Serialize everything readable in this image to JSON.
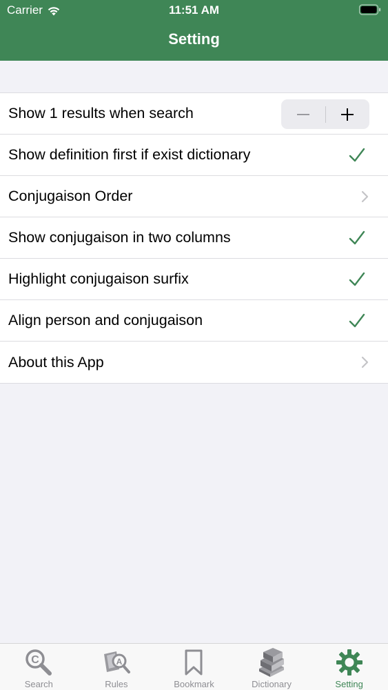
{
  "status_bar": {
    "carrier": "Carrier",
    "time": "11:51 AM"
  },
  "nav": {
    "title": "Setting"
  },
  "settings": {
    "rows": [
      {
        "label": "Show 1 results when search",
        "accessory": "stepper"
      },
      {
        "label": "Show definition first if exist dictionary",
        "accessory": "checkmark"
      },
      {
        "label": "Conjugaison Order",
        "accessory": "chevron"
      },
      {
        "label": "Show conjugaison in two columns",
        "accessory": "checkmark"
      },
      {
        "label": "Highlight conjugaison surfix",
        "accessory": "checkmark"
      },
      {
        "label": "Align person and conjugaison",
        "accessory": "checkmark"
      },
      {
        "label": "About this App",
        "accessory": "chevron"
      }
    ],
    "stepper": {
      "minus": "−",
      "plus": "+"
    }
  },
  "tabbar": {
    "tabs": [
      {
        "label": "Search",
        "icon": "search-icon",
        "active": false
      },
      {
        "label": "Rules",
        "icon": "rules-icon",
        "active": false
      },
      {
        "label": "Bookmark",
        "icon": "bookmark-icon",
        "active": false
      },
      {
        "label": "Dictionary",
        "icon": "dictionary-icon",
        "active": false
      },
      {
        "label": "Setting",
        "icon": "gear-icon",
        "active": true
      }
    ]
  },
  "colors": {
    "accent": "#3f8656",
    "background": "#f2f2f7",
    "inactive": "#8e8e93"
  }
}
